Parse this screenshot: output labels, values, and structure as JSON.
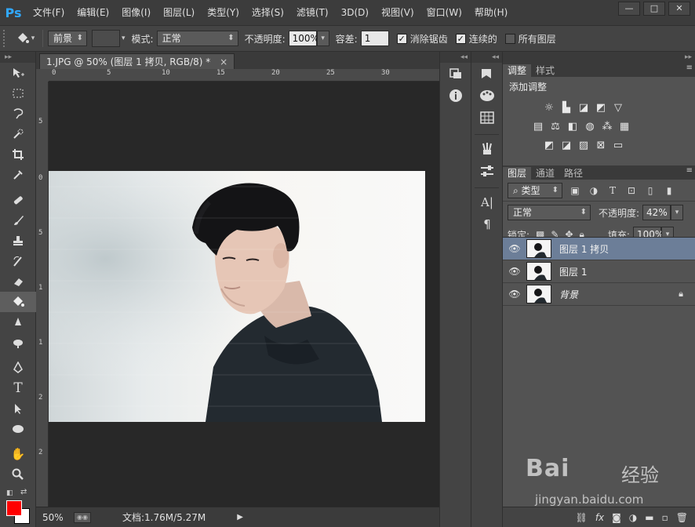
{
  "app": {
    "logo": "Ps"
  },
  "menu": [
    "文件(F)",
    "编辑(E)",
    "图像(I)",
    "图层(L)",
    "类型(Y)",
    "选择(S)",
    "滤镜(T)",
    "3D(D)",
    "视图(V)",
    "窗口(W)",
    "帮助(H)"
  ],
  "window_controls": {
    "minimize": "—",
    "maximize": "□",
    "close": "✕"
  },
  "options": {
    "fill_source": "前景",
    "mode_label": "模式:",
    "mode_value": "正常",
    "opacity_label": "不透明度:",
    "opacity_value": "100%",
    "tolerance_label": "容差:",
    "tolerance_value": "1",
    "antialias_label": "消除锯齿",
    "contiguous_label": "连续的",
    "all_layers_label": "所有图层"
  },
  "document": {
    "tab_title": "1.JPG @ 50% (图层 1 拷贝, RGB/8) *",
    "close": "×",
    "ruler_h": [
      "0",
      "5",
      "10",
      "15",
      "20",
      "25",
      "30"
    ],
    "ruler_v": [
      "5",
      "0",
      "5",
      "1",
      "1",
      "2",
      "2"
    ],
    "zoom": "50%",
    "doc_info": "文档:1.76M/5.27M"
  },
  "panels": {
    "adjust_tabs": [
      "调整",
      "样式"
    ],
    "adjust_title": "添加调整",
    "layers_tabs": [
      "图层",
      "通道",
      "路径"
    ],
    "filter_label": "类型",
    "blend_mode": "正常",
    "opacity_label": "不透明度:",
    "opacity_value": "42%",
    "lock_label": "锁定:",
    "fill_label": "填充:",
    "fill_value": "100%",
    "layers": [
      {
        "name": "图层 1 拷贝",
        "selected": true
      },
      {
        "name": "图层 1",
        "selected": false
      },
      {
        "name": "背景",
        "selected": false,
        "locked": true
      }
    ]
  },
  "watermark": {
    "logo": "Bai",
    "cn": "经验",
    "url": "jingyan.baidu.com"
  },
  "colors": {
    "foreground": "#ff0000",
    "background": "#ffffff",
    "selection": "#6c7e98",
    "accent": "#31a8ff"
  }
}
